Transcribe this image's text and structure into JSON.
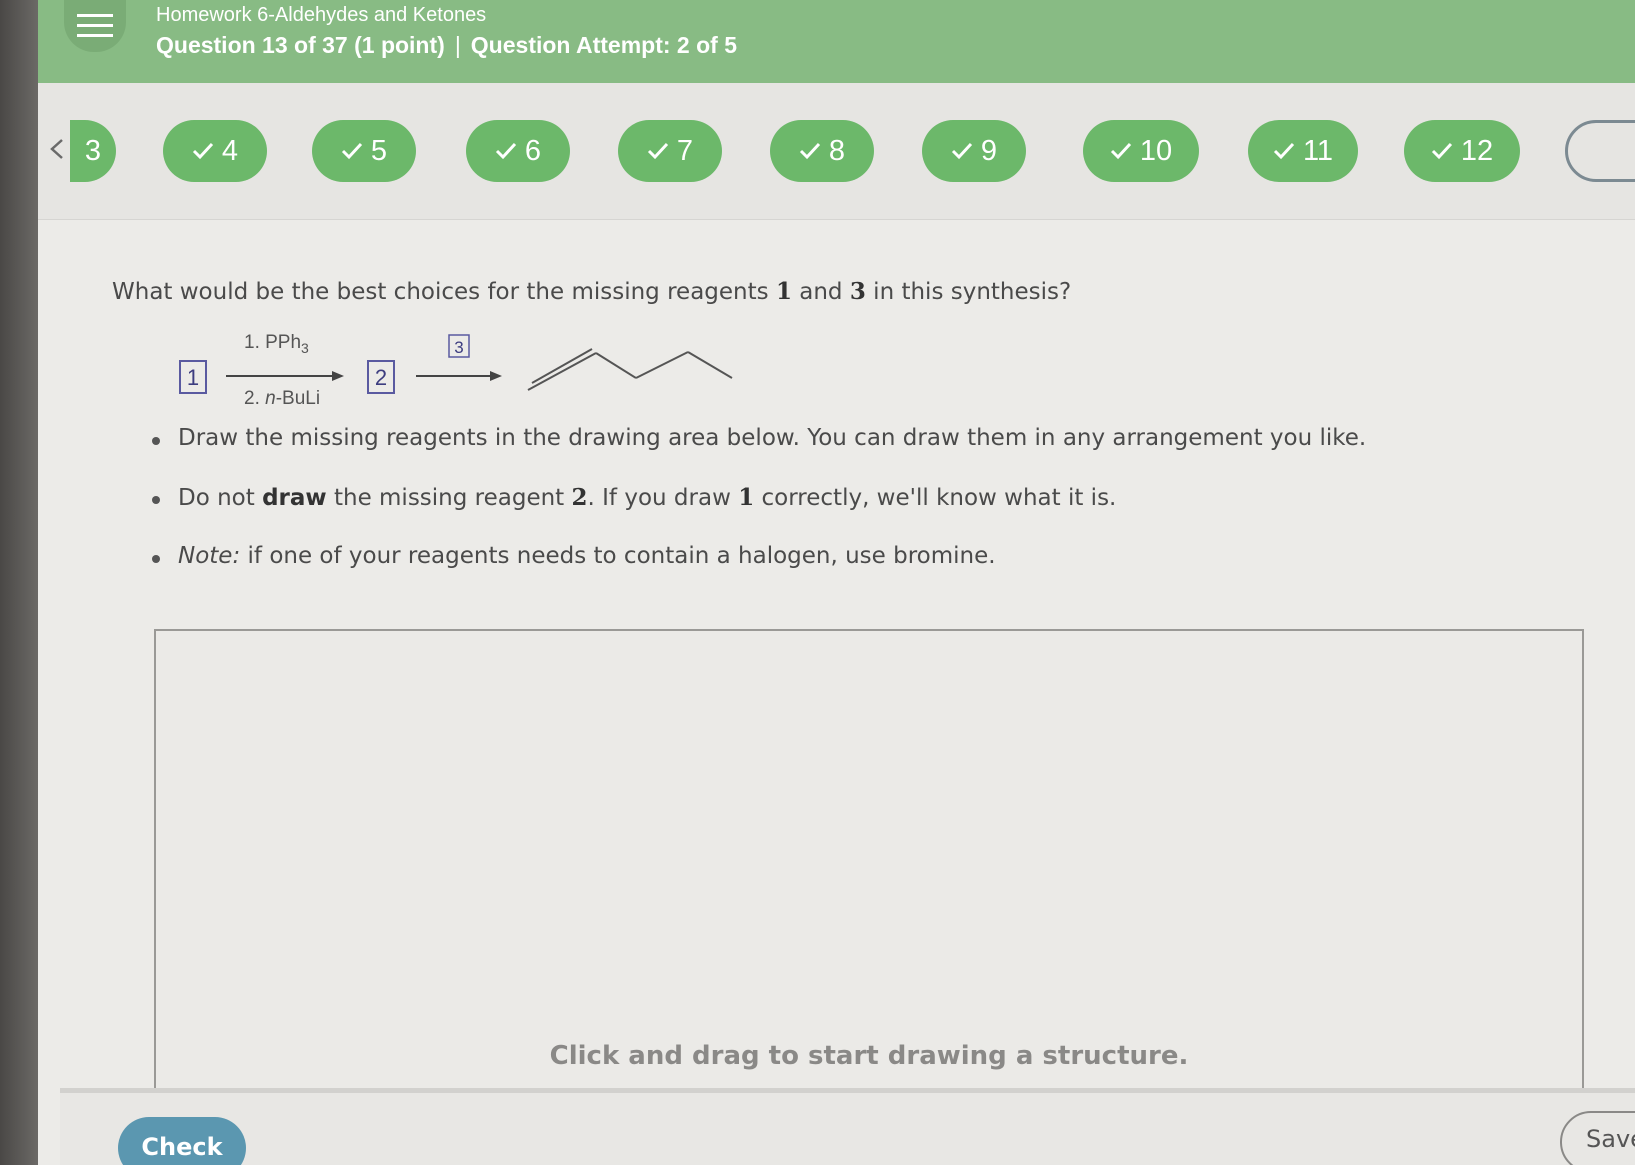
{
  "header": {
    "menu_icon": "hamburger-menu-icon",
    "title": "Homework 6-Aldehydes and Ketones",
    "question_position": "Question 13 of 37 (1 point)",
    "separator": "|",
    "attempt": "Question Attempt: 2 of 5",
    "bg_color": "#88bb84"
  },
  "nav": {
    "back_icon": "chevron-left-icon",
    "partial_label": "3",
    "items": [
      {
        "label": "4",
        "status": "correct"
      },
      {
        "label": "5",
        "status": "correct"
      },
      {
        "label": "6",
        "status": "correct"
      },
      {
        "label": "7",
        "status": "correct"
      },
      {
        "label": "8",
        "status": "correct"
      },
      {
        "label": "9",
        "status": "correct"
      },
      {
        "label": "10",
        "status": "correct"
      },
      {
        "label": "11",
        "status": "correct"
      },
      {
        "label": "12",
        "status": "correct"
      }
    ],
    "pill_color": "#6cb86a"
  },
  "question": {
    "prefix": "What would be the best choices for the missing reagents ",
    "num1": "1",
    "mid": " and ",
    "num3": "3",
    "suffix": " in this synthesis?"
  },
  "scheme": {
    "box1": "1",
    "step1_top_prefix": "1. PPh",
    "step1_top_sub": "3",
    "step1_bottom_prefix": "2. ",
    "step1_bottom_italic": "n",
    "step1_bottom_suffix": "-BuLi",
    "box2": "2",
    "box3": "3"
  },
  "bullets": {
    "b1": "Draw the missing reagents in the drawing area below. You can draw them in any arrangement you like.",
    "b2_pre": "Do not ",
    "b2_bold": "draw",
    "b2_mid": " the missing reagent ",
    "b2_num2": "2",
    "b2_mid2": ". If you draw ",
    "b2_num1": "1",
    "b2_suffix": " correctly, we'll know what it is.",
    "b3_italic": "Note:",
    "b3_rest": " if one of your reagents needs to contain a halogen, use bromine."
  },
  "drawing": {
    "hint": "Click and drag to start drawing a structure."
  },
  "footer": {
    "check_label": "Check",
    "save_label": "Save Fo",
    "check_color": "#5b97b0"
  }
}
